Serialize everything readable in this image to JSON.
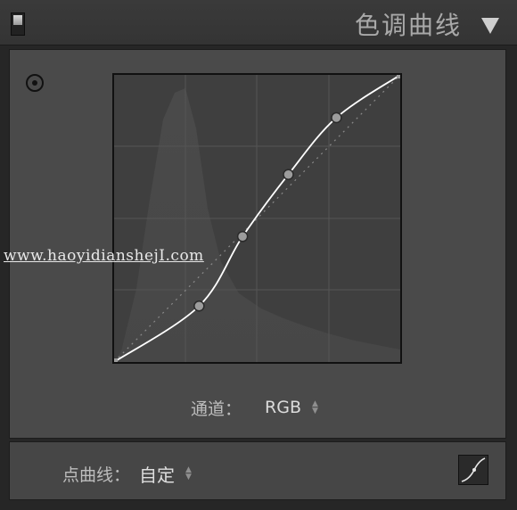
{
  "header": {
    "title": "色调曲线",
    "toggle_icon": "panel-switch-icon",
    "collapse_icon": "triangle-down-icon"
  },
  "tools": {
    "target_adjust_icon": "target-adjust-icon"
  },
  "curve": {
    "points": [
      [
        0,
        0
      ],
      [
        0.297,
        0.195
      ],
      [
        0.449,
        0.437
      ],
      [
        0.609,
        0.653
      ],
      [
        0.777,
        0.851
      ],
      [
        1,
        1
      ]
    ],
    "line_color": "#ffffff",
    "point_color": "#9c9c9c",
    "baseline_color": "#8a8a8a"
  },
  "watermark": {
    "text": "www.haoyidianshejI.com"
  },
  "channel": {
    "label": "通道：",
    "value": "RGB"
  },
  "point_curve": {
    "label": "点曲线：",
    "value": "自定",
    "edit_icon": "curve-edit-icon"
  },
  "colors": {
    "panel_bg": "#4a4a4a",
    "graph_bg": "#3f3f3f",
    "header_bg": "#383838"
  }
}
